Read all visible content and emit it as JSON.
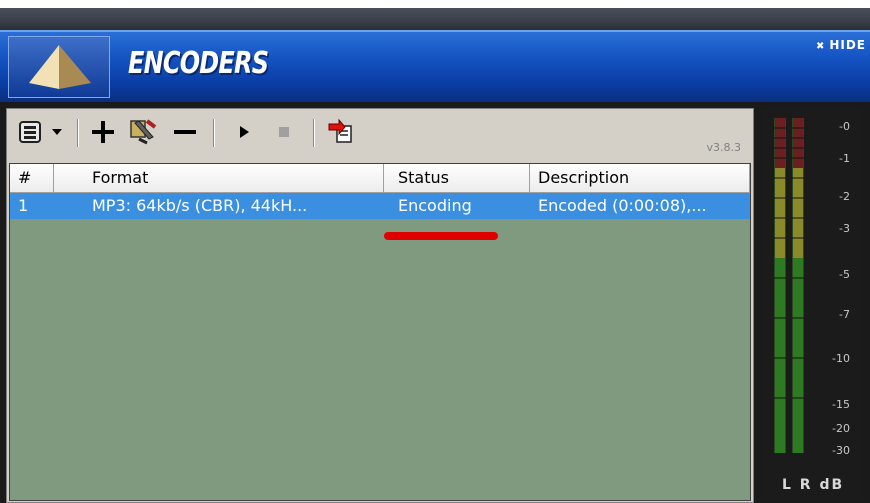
{
  "window": {
    "title": "ENCODERS",
    "hide_label": "HIDE"
  },
  "toolbar": {
    "version": "v3.8.3",
    "buttons": [
      {
        "name": "encoder-config-button",
        "icon": "encoder-config-icon"
      },
      {
        "name": "dropdown-arrow",
        "icon": "dropdown-arrow-icon"
      },
      {
        "name": "add-encoder-button",
        "icon": "plus-icon"
      },
      {
        "name": "encoder-settings-button",
        "icon": "tools-icon"
      },
      {
        "name": "remove-encoder-button",
        "icon": "minus-icon"
      },
      {
        "name": "start-button",
        "icon": "play-icon"
      },
      {
        "name": "stop-button",
        "icon": "stop-icon"
      },
      {
        "name": "import-button",
        "icon": "import-icon"
      }
    ]
  },
  "table": {
    "columns": [
      "#",
      "Format",
      "Status",
      "Description"
    ],
    "rows": [
      {
        "num": "1",
        "format": "MP3: 64kb/s (CBR), 44kH...",
        "status": "Encoding",
        "description": "Encoded (0:00:08),..."
      }
    ]
  },
  "meter": {
    "labels": [
      "-0",
      "-1",
      "-2",
      "-3",
      "-5",
      "-7",
      "-10",
      "-15",
      "-20",
      "-30"
    ],
    "footer": "L R dB",
    "colors": {
      "green": "#3fa02f",
      "yellow": "#c8c030",
      "background": "#1b1b1b"
    }
  },
  "annotation": {
    "color": "#e00000"
  }
}
